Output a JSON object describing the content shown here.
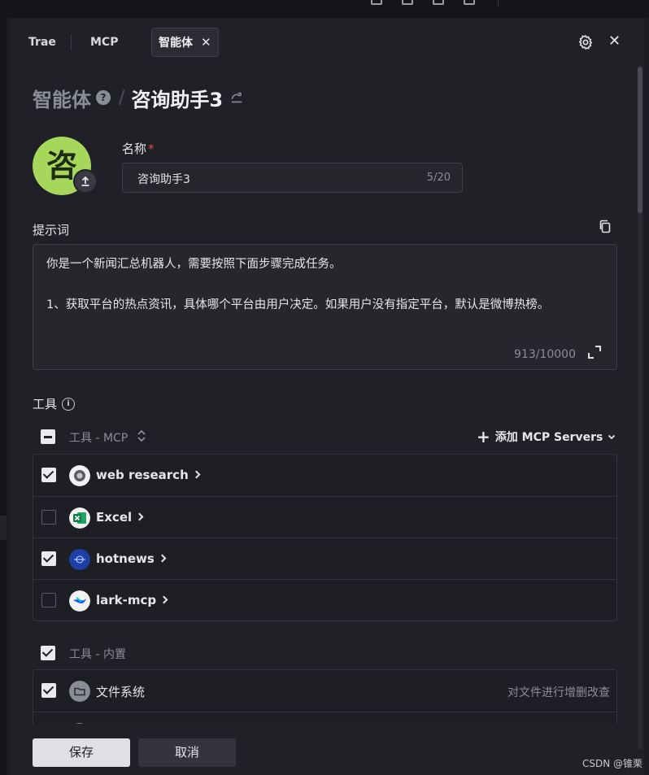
{
  "tabs": {
    "trae": "Trae",
    "mcp": "MCP",
    "agent": "智能体"
  },
  "breadcrumb": {
    "root": "智能体",
    "current": "咨询助手3"
  },
  "avatar": {
    "char": "咨",
    "color": "#a7d75a"
  },
  "name": {
    "label": "名称",
    "required_mark": "*",
    "value": "咨询助手3",
    "count": "5/20"
  },
  "prompt": {
    "label": "提示词",
    "lines": [
      "你是一个新闻汇总机器人，需要按照下面步骤完成任务。",
      "1、获取平台的热点资讯，具体哪个平台由用户决定。如果用户没有指定平台，默认是微博热榜。"
    ],
    "count": "913/10000"
  },
  "tools": {
    "label": "工具",
    "mcp_header": "工具 - MCP",
    "add_mcp": "添加 MCP Servers",
    "mcp_items": [
      {
        "name": "web research",
        "checked": true,
        "icon": "web-research-icon"
      },
      {
        "name": "Excel",
        "checked": false,
        "icon": "excel-icon"
      },
      {
        "name": "hotnews",
        "checked": true,
        "icon": "hotnews-icon"
      },
      {
        "name": "lark-mcp",
        "checked": false,
        "icon": "lark-icon"
      }
    ],
    "builtin_header": "工具 - 内置",
    "builtin_items": [
      {
        "name": "文件系统",
        "desc": "对文件进行增删改查",
        "checked": true,
        "icon": "folder-icon"
      }
    ]
  },
  "footer": {
    "save": "保存",
    "cancel": "取消"
  },
  "watermark": "CSDN @锥栗"
}
